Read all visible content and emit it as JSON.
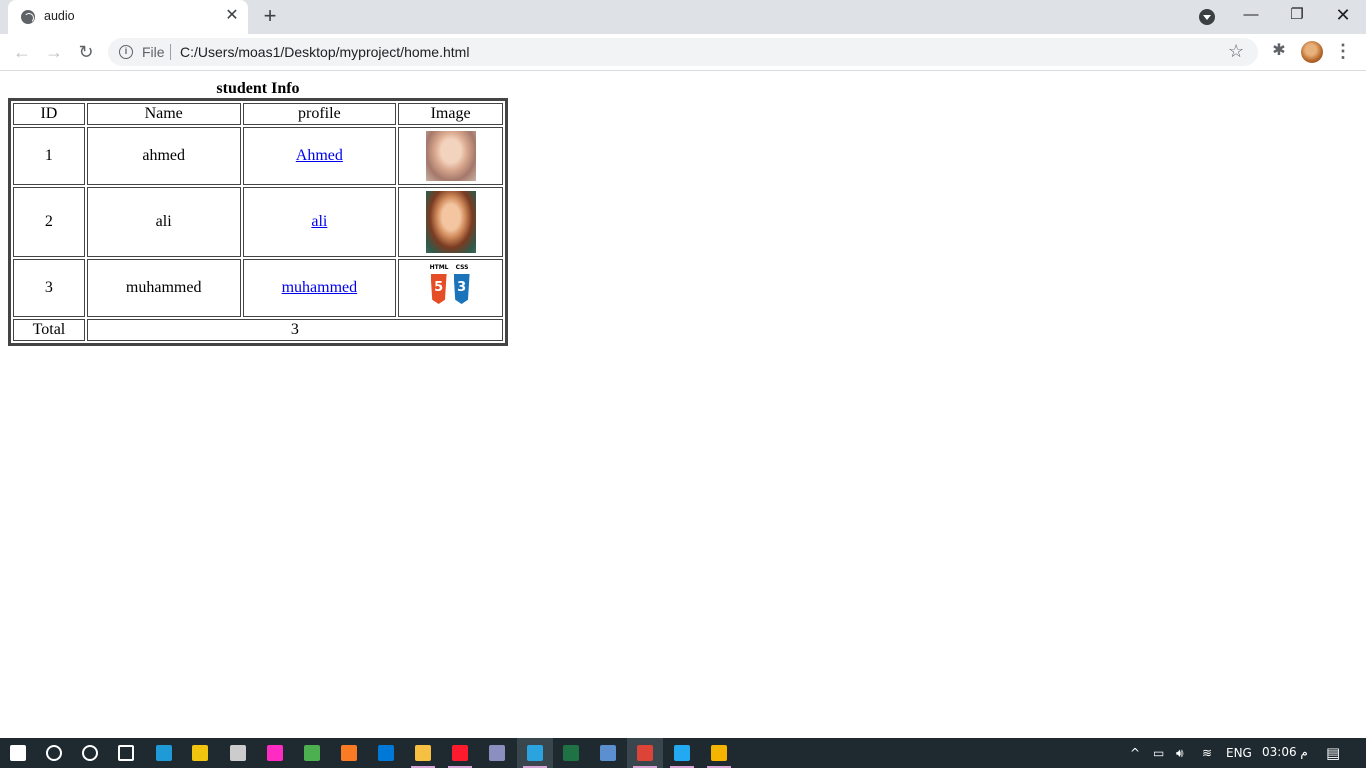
{
  "browser": {
    "tab_title": "audio",
    "scheme_label": "File",
    "url": "C:/Users/moas1/Desktop/myproject/home.html",
    "win_minimize": "—",
    "win_restore": "❐",
    "win_close": "✕",
    "tab_close": "✕",
    "new_tab": "+",
    "back": "←",
    "forward": "→",
    "reload": "↻",
    "info": "i",
    "star": "☆",
    "extensions": "✱",
    "menu": "⋮"
  },
  "table": {
    "caption": "student Info",
    "headers": [
      "ID",
      "Name",
      "profile",
      "Image"
    ],
    "rows": [
      {
        "id": "1",
        "name": "ahmed",
        "profile": "Ahmed",
        "image": "child-portrait-photo"
      },
      {
        "id": "2",
        "name": "ali",
        "profile": "ali",
        "image": "child-portrait-photo-2"
      },
      {
        "id": "3",
        "name": "muhammed",
        "profile": "muhammed",
        "image": "html5-css3-logos"
      }
    ],
    "total_label": "Total",
    "total_value": "3",
    "logo_text": {
      "html_label": "HTML",
      "css_label": "CSS",
      "html_digit": "5",
      "css_digit": "3"
    }
  },
  "taskbar": {
    "tray_language": "ENG",
    "clock": "03:06 م",
    "tray_symbols": {
      "up": "^",
      "battery": "▭",
      "volume": "🔊︎",
      "wifi": "≋"
    },
    "apps": [
      {
        "name": "start",
        "color": "#ffffff"
      },
      {
        "name": "search",
        "color": "#ffffff"
      },
      {
        "name": "cortana",
        "color": "#ffffff"
      },
      {
        "name": "task-view",
        "color": "#ffffff"
      },
      {
        "name": "edge",
        "color": "#1e9ad6"
      },
      {
        "name": "store",
        "color": "#f1c40f"
      },
      {
        "name": "cmd",
        "color": "#cccccc"
      },
      {
        "name": "adobe-xd",
        "color": "#ff2bc2"
      },
      {
        "name": "green-app",
        "color": "#4caf50"
      },
      {
        "name": "xampp",
        "color": "#fb7a24"
      },
      {
        "name": "mail",
        "color": "#0078d7"
      },
      {
        "name": "file-explorer",
        "color": "#f6c142"
      },
      {
        "name": "opera",
        "color": "#ff1b2d"
      },
      {
        "name": "generic-app",
        "color": "#8a8fbf"
      },
      {
        "name": "telegram",
        "color": "#2aa3df"
      },
      {
        "name": "excel",
        "color": "#1f7244"
      },
      {
        "name": "network-app",
        "color": "#5b8fd0"
      },
      {
        "name": "chrome",
        "color": "#db4437"
      },
      {
        "name": "vscode",
        "color": "#23a9f2"
      },
      {
        "name": "chrome-2",
        "color": "#f4b400"
      }
    ]
  }
}
